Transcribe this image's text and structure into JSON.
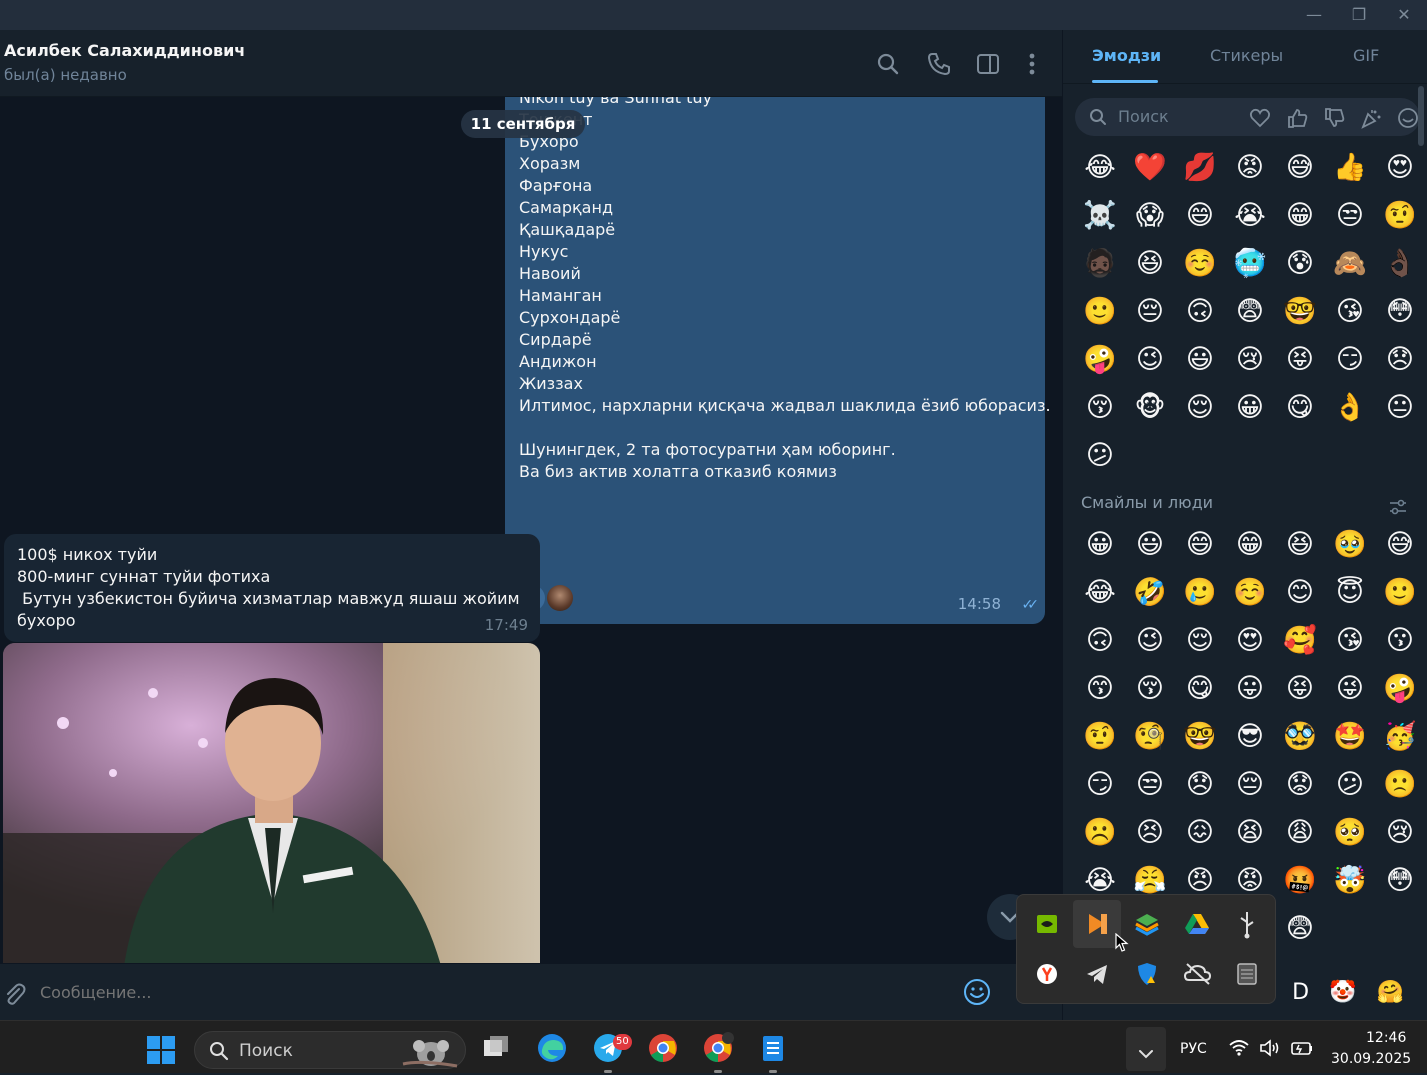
{
  "window": {
    "minimize": "—",
    "maximize": "❐",
    "close": "✕"
  },
  "chat": {
    "name": "Асилбек Салахиддинович",
    "status": "был(а) недавно",
    "date_pill": "11 сентября",
    "outgoing": {
      "lines": "Nikoh tuy ва Sunnat tuy\nТошкент\nБухоро\nХоразм\nФарғона\nСамарқанд\nҚашқадарё\nНукус\nНавоий\nНаманган\nСурхондарё\nСирдарё\nАндижон\nЖиззах\nИлтимос, нархларни қисқача жадвал шаклида ёзиб юборасиз.\n\nШунингдек, 2 та фотосуратни ҳам юборинг.\nВа биз актив холатга отказиб коямиз",
      "time": "14:58",
      "reaction_heart": "❤"
    },
    "incoming": {
      "lines": "100$ никох туйи\n800-минг суннат туйи фотиха\n Бутун узбекистон буйича хизматлар мавжуд яшаш жойим\nбухоро",
      "time": "17:49"
    },
    "input_placeholder": "Сообщение..."
  },
  "panel": {
    "tabs": [
      "Эмодзи",
      "Стикеры",
      "GIF"
    ],
    "search_placeholder": "Поиск",
    "section_title": "Смайлы и люди",
    "recent": [
      "😂",
      "❤️",
      "💋",
      "😡",
      "😅",
      "👍",
      "😍",
      "☠️",
      "😱",
      "😄",
      "😭",
      "😁",
      "😒",
      "🤨",
      "🧔🏿",
      "😆",
      "☺️",
      "🥶",
      "😰",
      "🙈",
      "👌🏿",
      "🙂",
      "😔",
      "🙃",
      "😨",
      "🤓",
      "😘",
      "😳",
      "🤪",
      "😉",
      "😃",
      "😢",
      "😝",
      "😏",
      "😞",
      "😚",
      "🐵",
      "😌",
      "😀",
      "😋",
      "👌",
      "😐",
      "😕"
    ],
    "smileys": [
      "😀",
      "😃",
      "😄",
      "😁",
      "😆",
      "🥹",
      "😅",
      "😂",
      "🤣",
      "🥲",
      "☺️",
      "😊",
      "😇",
      "🙂",
      "🙃",
      "😉",
      "😌",
      "😍",
      "🥰",
      "😘",
      "😗",
      "😙",
      "😚",
      "😋",
      "😛",
      "😝",
      "😜",
      "🤪",
      "🤨",
      "🧐",
      "🤓",
      "😎",
      "🥸",
      "🤩",
      "🥳",
      "😏",
      "😒",
      "😞",
      "😔",
      "😟",
      "😕",
      "🙁",
      "☹️",
      "😣",
      "😖",
      "😫",
      "😩",
      "🥺",
      "😢",
      "😭",
      "😤",
      "😠",
      "😡",
      "🤬",
      "🤯",
      "😳",
      "🥵",
      "🥶",
      "😶‍🌫️",
      "😱",
      "😨"
    ],
    "bottom_row": [
      "😥",
      "🙂",
      "😒",
      "😶",
      "🐱",
      "D",
      "🤡",
      "🤗"
    ]
  },
  "tray": {
    "icons": [
      "nvidia-icon",
      "orange-app-icon",
      "layers-app-icon",
      "google-drive-icon",
      "usb-icon",
      "yandex-icon",
      "telegram-icon",
      "security-shield-icon",
      "cloud-off-icon",
      "tablet-icon"
    ]
  },
  "taskbar": {
    "search_label": "Поиск",
    "telegram_badge": "50",
    "language": "РУС",
    "time": "12:46",
    "date": "30.09.2025"
  },
  "colors": {
    "accent": "#5eb5f7",
    "outgoing_bubble": "#2b5278",
    "incoming_bubble": "#182533",
    "chat_bg": "#0e1621"
  }
}
